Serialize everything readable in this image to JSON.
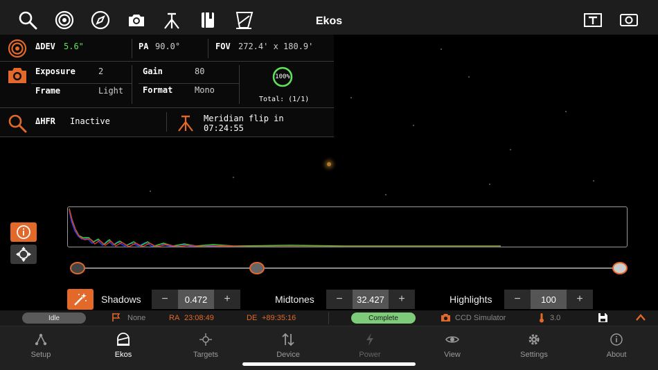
{
  "app_title": "Ekos",
  "toolbar": {
    "left_icons": [
      "search-icon",
      "guide-target-icon",
      "compass-icon",
      "camera-icon",
      "tripod-icon",
      "notebook-icon",
      "flat-panel-icon"
    ],
    "right_icons": [
      "text-overlay-icon",
      "capture-frame-icon"
    ]
  },
  "panel": {
    "guide": {
      "dev_label": "ΔDEV",
      "dev_value": "5.6\"",
      "pa_label": "PA",
      "pa_value": "90.0°",
      "fov_label": "FOV",
      "fov_value": "272.4' x 180.9'"
    },
    "capture": {
      "exposure_label": "Exposure",
      "exposure_value": "2",
      "gain_label": "Gain",
      "gain_value": "80",
      "frame_label": "Frame",
      "frame_value": "Light",
      "format_label": "Format",
      "format_value": "Mono",
      "progress_text": "100%",
      "progress_fraction": 1.0,
      "total_text": "Total: (1/1)"
    },
    "focus": {
      "hfr_label": "ΔHFR",
      "hfr_value": "Inactive",
      "meridian_text_1": "Meridian flip in",
      "meridian_text_2": "07:24:55"
    }
  },
  "stretch": {
    "shadows_label": "Shadows",
    "shadows_value": "0.472",
    "midtones_label": "Midtones",
    "midtones_value": "32.427",
    "highlights_label": "Highlights",
    "highlights_value": "100",
    "minus": "−",
    "plus": "+"
  },
  "status": {
    "state": "Idle",
    "mount_label": "None",
    "ra_label": "RA",
    "ra_value": "23:08:49",
    "de_label": "DE",
    "de_value": "+89:35:16",
    "capture_state": "Complete",
    "camera_name": "CCD Simulator",
    "temperature": "3.0"
  },
  "tabs": [
    {
      "label": "Setup",
      "icon": "setup-icon"
    },
    {
      "label": "Ekos",
      "icon": "ekos-icon",
      "active": true
    },
    {
      "label": "Targets",
      "icon": "targets-icon"
    },
    {
      "label": "Device",
      "icon": "device-icon"
    },
    {
      "label": "Power",
      "icon": "power-icon"
    },
    {
      "label": "View",
      "icon": "view-icon"
    },
    {
      "label": "Settings",
      "icon": "settings-icon"
    },
    {
      "label": "About",
      "icon": "about-icon"
    }
  ],
  "colors": {
    "accent": "#e2692a",
    "progress": "#5fe35a",
    "idle_pill": "#5a5a5a",
    "complete_pill": "#7ecb7a",
    "ra_de_label": "#e2692a"
  }
}
